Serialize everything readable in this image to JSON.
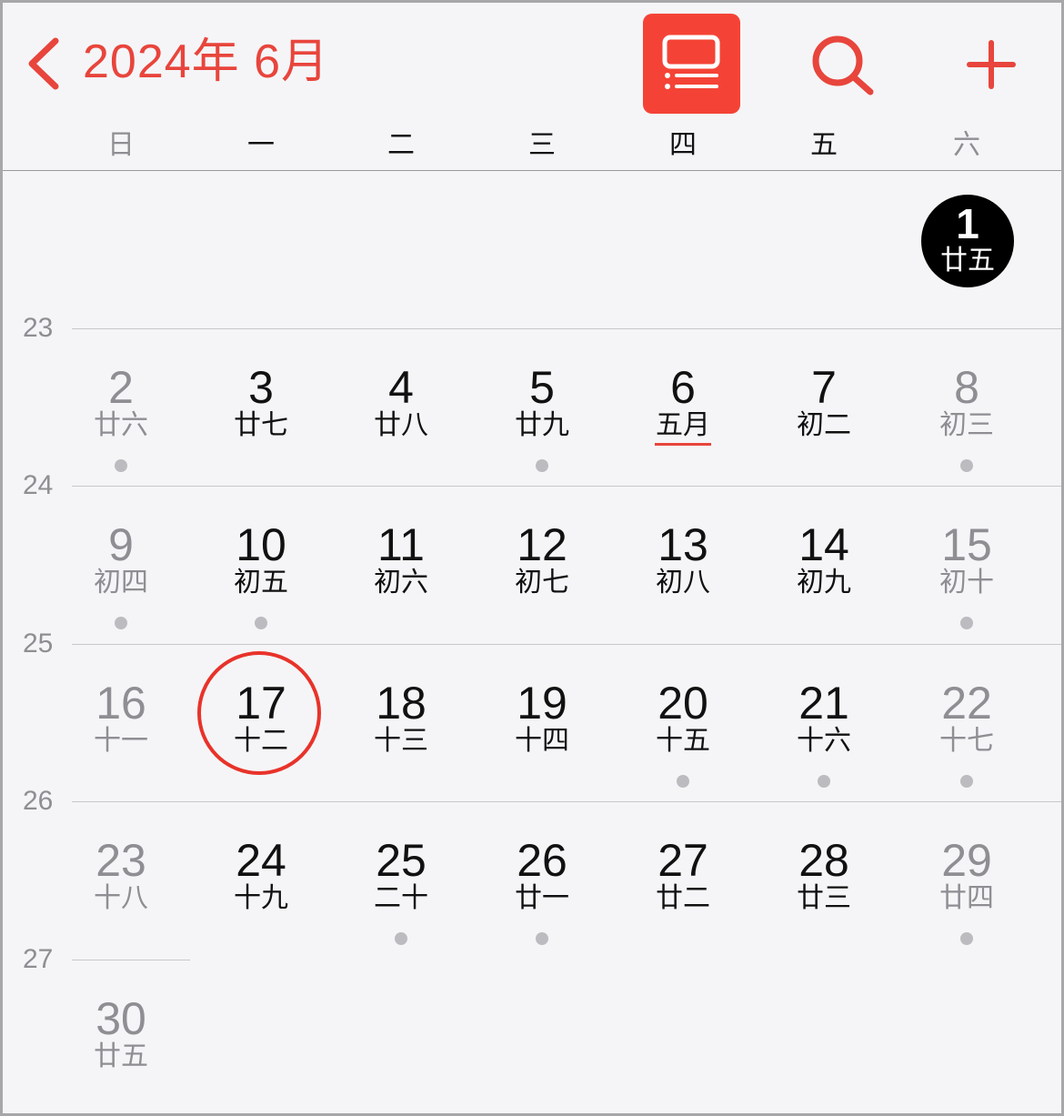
{
  "header": {
    "title": "2024年 6月",
    "back_icon": "chevron-left-icon",
    "list_view_icon": "list-view-icon",
    "search_icon": "search-icon",
    "add_icon": "plus-icon",
    "accent_color": "#e8453c"
  },
  "weekdays": [
    "日",
    "一",
    "二",
    "三",
    "四",
    "五",
    "六"
  ],
  "week_numbers": [
    "23",
    "24",
    "25",
    "26",
    "27"
  ],
  "first_day": {
    "day": "1",
    "lunar": "廿五"
  },
  "weeks": [
    [
      {
        "day": "2",
        "lunar": "廿六",
        "dot": true
      },
      {
        "day": "3",
        "lunar": "廿七",
        "dot": false
      },
      {
        "day": "4",
        "lunar": "廿八",
        "dot": false
      },
      {
        "day": "5",
        "lunar": "廿九",
        "dot": true
      },
      {
        "day": "6",
        "lunar": "五月",
        "dot": false,
        "underline": true
      },
      {
        "day": "7",
        "lunar": "初二",
        "dot": false
      },
      {
        "day": "8",
        "lunar": "初三",
        "dot": true
      }
    ],
    [
      {
        "day": "9",
        "lunar": "初四",
        "dot": true
      },
      {
        "day": "10",
        "lunar": "初五",
        "dot": true
      },
      {
        "day": "11",
        "lunar": "初六",
        "dot": false
      },
      {
        "day": "12",
        "lunar": "初七",
        "dot": false
      },
      {
        "day": "13",
        "lunar": "初八",
        "dot": false
      },
      {
        "day": "14",
        "lunar": "初九",
        "dot": false
      },
      {
        "day": "15",
        "lunar": "初十",
        "dot": true
      }
    ],
    [
      {
        "day": "16",
        "lunar": "十一",
        "dot": false
      },
      {
        "day": "17",
        "lunar": "十二",
        "dot": false,
        "today": true
      },
      {
        "day": "18",
        "lunar": "十三",
        "dot": false
      },
      {
        "day": "19",
        "lunar": "十四",
        "dot": false
      },
      {
        "day": "20",
        "lunar": "十五",
        "dot": true
      },
      {
        "day": "21",
        "lunar": "十六",
        "dot": true
      },
      {
        "day": "22",
        "lunar": "十七",
        "dot": true
      }
    ],
    [
      {
        "day": "23",
        "lunar": "十八",
        "dot": false
      },
      {
        "day": "24",
        "lunar": "十九",
        "dot": false
      },
      {
        "day": "25",
        "lunar": "二十",
        "dot": true
      },
      {
        "day": "26",
        "lunar": "廿一",
        "dot": true
      },
      {
        "day": "27",
        "lunar": "廿二",
        "dot": false
      },
      {
        "day": "28",
        "lunar": "廿三",
        "dot": false
      },
      {
        "day": "29",
        "lunar": "廿四",
        "dot": true
      }
    ],
    [
      {
        "day": "30",
        "lunar": "廿五",
        "dot": false
      }
    ]
  ]
}
